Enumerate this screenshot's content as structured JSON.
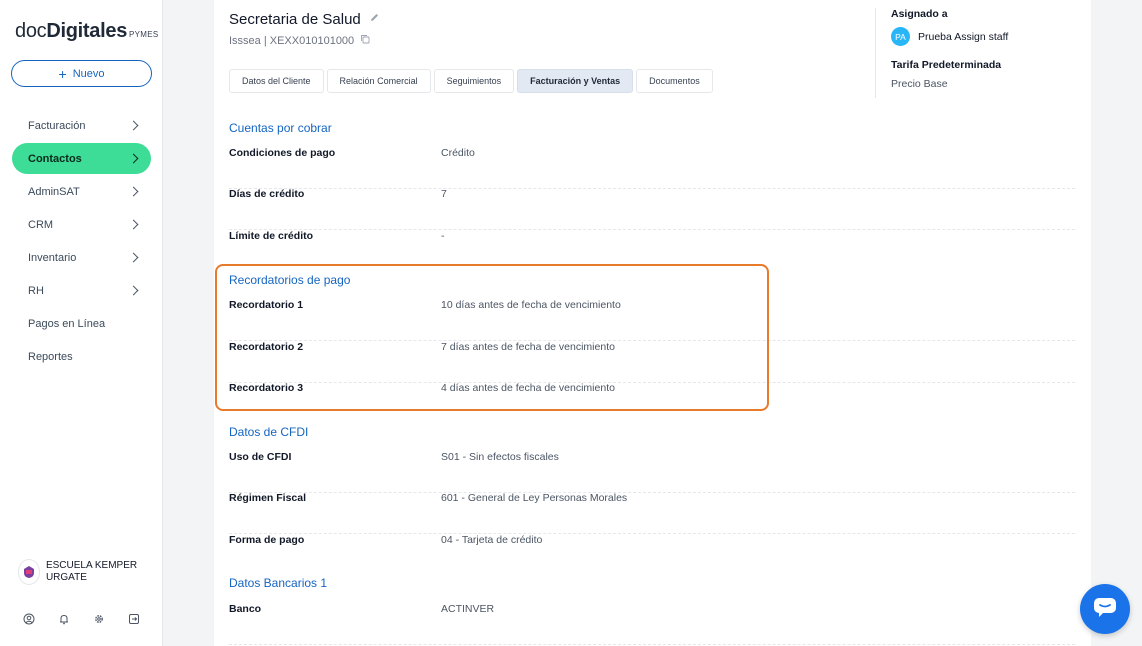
{
  "brand": {
    "doc": "doc",
    "digitales": "Digitales",
    "pymes": "PYMES"
  },
  "nuevo_label": "Nuevo",
  "nav": [
    {
      "label": "Facturación",
      "chevron": true
    },
    {
      "label": "Contactos",
      "chevron": true,
      "active": true
    },
    {
      "label": "AdminSAT",
      "chevron": true
    },
    {
      "label": "CRM",
      "chevron": true
    },
    {
      "label": "Inventario",
      "chevron": true
    },
    {
      "label": "RH",
      "chevron": true
    },
    {
      "label": "Pagos en Línea",
      "chevron": false
    },
    {
      "label": "Reportes",
      "chevron": false
    }
  ],
  "org_name": "ESCUELA KEMPER URGATE",
  "client": {
    "title": "Secretaria de Salud",
    "subtitle": "Isssea | XEXX010101000"
  },
  "tabs": [
    {
      "label": "Datos del Cliente"
    },
    {
      "label": "Relación Comercial"
    },
    {
      "label": "Seguimientos"
    },
    {
      "label": "Facturación y Ventas",
      "active": true
    },
    {
      "label": "Documentos"
    }
  ],
  "assigned": {
    "label": "Asignado a",
    "initials": "PA",
    "staff": "Prueba Assign staff",
    "tarifa_label": "Tarifa Predeterminada",
    "tarifa_value": "Precio Base"
  },
  "sections": {
    "cuentas": {
      "title": "Cuentas por cobrar",
      "rows": [
        {
          "k": "Condiciones de pago",
          "v": "Crédito"
        },
        {
          "k": "Días de crédito",
          "v": "7"
        },
        {
          "k": "Límite de crédito",
          "v": "-"
        }
      ]
    },
    "recordatorios": {
      "title": "Recordatorios de pago",
      "rows": [
        {
          "k": "Recordatorio 1",
          "v": "10 días antes de fecha de vencimiento"
        },
        {
          "k": "Recordatorio 2",
          "v": "7 días antes de fecha de vencimiento"
        },
        {
          "k": "Recordatorio 3",
          "v": "4 días antes de fecha de vencimiento"
        }
      ]
    },
    "cfdi": {
      "title": "Datos de CFDI",
      "rows": [
        {
          "k": "Uso de CFDI",
          "v": "S01 - Sin efectos fiscales"
        },
        {
          "k": "Régimen Fiscal",
          "v": "601 - General de Ley Personas Morales"
        },
        {
          "k": "Forma de pago",
          "v": "04 - Tarjeta de crédito"
        }
      ]
    },
    "bancarios": {
      "title": "Datos Bancarios 1",
      "rows": [
        {
          "k": "Banco",
          "v": "ACTINVER"
        }
      ]
    }
  },
  "colors": {
    "accent": "#1565c0",
    "active_nav": "#3ddc97",
    "highlight": "#e87a2b",
    "chat": "#1a73e8"
  }
}
